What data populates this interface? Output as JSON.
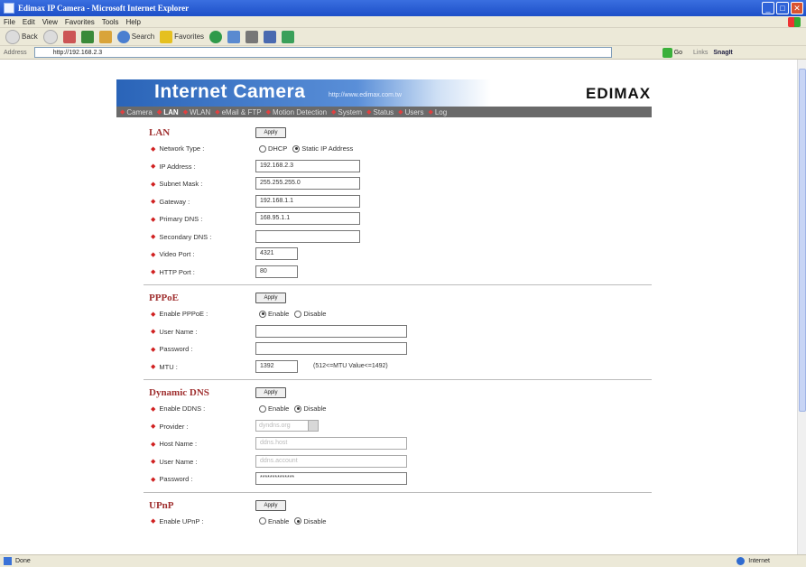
{
  "window": {
    "title": "Edimax IP Camera - Microsoft Internet Explorer",
    "controls": [
      "_",
      "□",
      "✕"
    ]
  },
  "menubar": [
    "File",
    "Edit",
    "View",
    "Favorites",
    "Tools",
    "Help"
  ],
  "toolbar": {
    "back": "Back",
    "search": "Search",
    "favorites": "Favorites"
  },
  "addressbar": {
    "label": "Address",
    "url": "http://192.168.2.3",
    "go": "Go",
    "links": "Links",
    "snagit": "SnagIt"
  },
  "banner": {
    "title": "Internet Camera",
    "url": "http://www.edimax.com.tw",
    "logo": "EDIMAX"
  },
  "nav": [
    {
      "label": "Camera",
      "active": false
    },
    {
      "label": "LAN",
      "active": true
    },
    {
      "label": "WLAN",
      "active": false
    },
    {
      "label": "eMail & FTP",
      "active": false
    },
    {
      "label": "Motion Detection",
      "active": false
    },
    {
      "label": "System",
      "active": false
    },
    {
      "label": "Status",
      "active": false
    },
    {
      "label": "Users",
      "active": false
    },
    {
      "label": "Log",
      "active": false
    }
  ],
  "lan": {
    "title": "LAN",
    "apply": "Apply",
    "network_type_label": "Network Type :",
    "network_type_options": [
      "DHCP",
      "Static IP Address"
    ],
    "network_type_selected": "Static IP Address",
    "ip_label": "IP Address :",
    "ip_value": "192.168.2.3",
    "subnet_label": "Subnet Mask :",
    "subnet_value": "255.255.255.0",
    "gateway_label": "Gateway :",
    "gateway_value": "192.168.1.1",
    "primary_dns_label": "Primary DNS :",
    "primary_dns_value": "168.95.1.1",
    "secondary_dns_label": "Secondary DNS :",
    "secondary_dns_value": "",
    "video_port_label": "Video Port :",
    "video_port_value": "4321",
    "http_port_label": "HTTP Port :",
    "http_port_value": "80"
  },
  "pppoe": {
    "title": "PPPoE",
    "apply": "Apply",
    "enable_label": "Enable PPPoE :",
    "options": [
      "Enable",
      "Disable"
    ],
    "selected": "Enable",
    "username_label": "User Name :",
    "username_value": "",
    "password_label": "Password :",
    "password_value": "",
    "mtu_label": "MTU :",
    "mtu_value": "1392",
    "mtu_hint": "(512<=MTU Value<=1492)"
  },
  "ddns": {
    "title": "Dynamic DNS",
    "apply": "Apply",
    "enable_label": "Enable DDNS :",
    "options": [
      "Enable",
      "Disable"
    ],
    "selected": "Disable",
    "provider_label": "Provider :",
    "provider_value": "dyndns.org",
    "hostname_label": "Host Name :",
    "hostname_value": "ddns.host",
    "username_label": "User Name :",
    "username_value": "ddns.account",
    "password_label": "Password :",
    "password_value": "**************"
  },
  "upnp": {
    "title": "UPnP",
    "apply": "Apply",
    "enable_label": "Enable UPnP :",
    "options": [
      "Enable",
      "Disable"
    ],
    "selected": "Disable"
  },
  "status": {
    "left": "Done",
    "right": "Internet"
  }
}
